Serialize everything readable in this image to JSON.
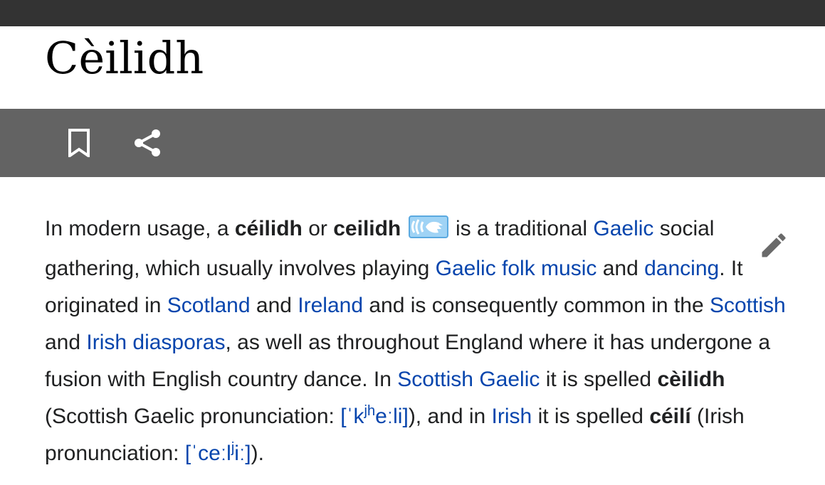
{
  "page": {
    "title": "Cèilidh"
  },
  "toolbar": {
    "bookmark_icon": "bookmark-icon",
    "share_icon": "share-icon",
    "edit_icon": "pencil-icon"
  },
  "article": {
    "p1": "In modern usage, a ",
    "b_ceilidh_acute": "céilidh",
    "p2": " or ",
    "b_ceilidh": "ceilidh",
    "audio_icon": "audio-speaker-icon",
    "p3": " is a traditional ",
    "link_gaelic": "Gaelic",
    "p4": " social gathering, which usually involves playing ",
    "link_gaelic_folk_music": "Gaelic folk music",
    "p5": " and ",
    "link_dancing": "dancing",
    "p6": ". It originated in ",
    "link_scotland": "Scotland",
    "p7": " and ",
    "link_ireland": "Ireland",
    "p8": " and is consequently common in the ",
    "link_scottish": "Scottish",
    "p9": " and ",
    "link_irish_diasporas": "Irish diasporas",
    "p10": ", as well as throughout England where it has undergone a fusion with English country dance. In ",
    "link_scottish_gaelic": "Scottish Gaelic",
    "p11": " it is spelled ",
    "b_ceilidh_grave": "cèilidh",
    "p12": " (Scottish Gaelic pronunciation: ",
    "ipa1_a": "[ˈk",
    "ipa1_sup": "jh",
    "ipa1_b": "eːli]",
    "p13": "), and in ",
    "link_irish": "Irish",
    "p14": " it is spelled ",
    "b_ceili": "céilí",
    "p15": " (Irish pronunciation: ",
    "ipa2_a": "[ˈceːl",
    "ipa2_sup": "j",
    "ipa2_b": "iː]",
    "p16": ")."
  }
}
